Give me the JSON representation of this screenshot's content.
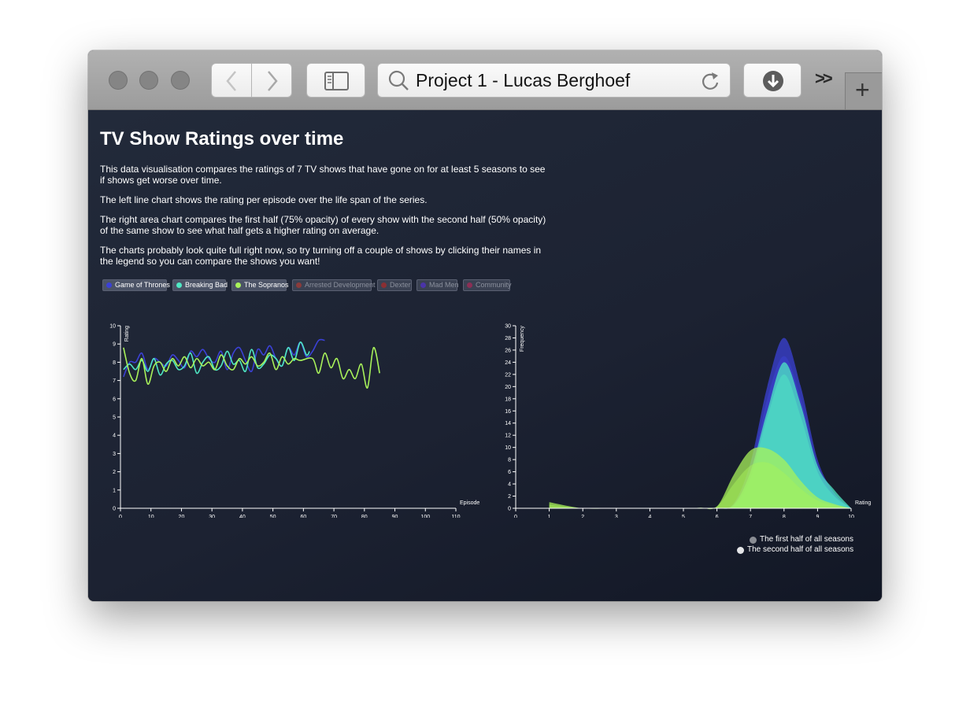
{
  "browser": {
    "address_title": "Project 1 - Lucas Berghoef",
    "overflow_label": ">>",
    "new_tab_label": "+"
  },
  "page": {
    "title": "TV Show Ratings over time",
    "paragraphs": [
      "This data visualisation compares the ratings of 7 TV shows that have gone on for at least 5 seasons to see if shows get worse over time.",
      "The left line chart shows the rating per episode over the life span of the series.",
      "The right area chart compares the first half (75% opacity) of every show with the second half (50% opacity) of the same show to see what half gets a higher rating on average.",
      "The charts probably look quite full right now, so try turning off a couple of shows by clicking their names in the legend so you can compare the shows you want!"
    ]
  },
  "legend": {
    "shows": [
      {
        "label": "Game of Thrones",
        "color": "#3b41d6",
        "active": true
      },
      {
        "label": "Breaking Bad",
        "color": "#4fe8c4",
        "active": true
      },
      {
        "label": "The Sopranos",
        "color": "#a8f25a",
        "active": true
      },
      {
        "label": "Arrested Development",
        "color": "#8a3b3b",
        "active": false
      },
      {
        "label": "Dexter",
        "color": "#8a2f33",
        "active": false
      },
      {
        "label": "Mad Men",
        "color": "#4a34a8",
        "active": false
      },
      {
        "label": "Community",
        "color": "#8a2f55",
        "active": false
      }
    ]
  },
  "area_legend": {
    "first": {
      "label": "The first half of all seasons",
      "color": "#8a8d94"
    },
    "second": {
      "label": "The second half of all seasons",
      "color": "#e4e5e8"
    }
  },
  "chart_data": [
    {
      "type": "line",
      "xlabel": "Episode",
      "ylabel": "Rating",
      "xlim": [
        0,
        110
      ],
      "ylim": [
        0,
        10
      ],
      "x_ticks": [
        0,
        10,
        20,
        30,
        40,
        50,
        60,
        70,
        80,
        90,
        100,
        110
      ],
      "y_ticks": [
        0,
        1,
        2,
        3,
        4,
        5,
        6,
        7,
        8,
        9,
        10
      ],
      "grid": false,
      "series": [
        {
          "name": "Game of Thrones",
          "color": "#3b41d6",
          "x": [
            1,
            3,
            5,
            7,
            9,
            11,
            13,
            15,
            17,
            19,
            21,
            23,
            25,
            27,
            29,
            31,
            33,
            35,
            37,
            39,
            41,
            43,
            45,
            47,
            49,
            51,
            53,
            55,
            57,
            59,
            61,
            63,
            65,
            67
          ],
          "y": [
            7.2,
            8.0,
            8.0,
            8.5,
            7.6,
            8.2,
            8.0,
            7.8,
            8.4,
            8.1,
            7.7,
            8.6,
            8.3,
            8.7,
            8.2,
            8.0,
            8.6,
            7.6,
            8.5,
            8.8,
            8.1,
            7.5,
            8.7,
            8.4,
            8.9,
            8.2,
            7.8,
            8.8,
            8.4,
            9.1,
            8.3,
            8.6,
            9.2,
            9.2
          ]
        },
        {
          "name": "Breaking Bad",
          "color": "#4fe8c4",
          "x": [
            1,
            3,
            5,
            7,
            9,
            11,
            13,
            15,
            17,
            19,
            21,
            23,
            25,
            27,
            29,
            31,
            33,
            35,
            37,
            39,
            41,
            43,
            45,
            47,
            49,
            51,
            53,
            55,
            57,
            59,
            61,
            62
          ],
          "y": [
            7.6,
            7.9,
            7.6,
            8.1,
            7.5,
            8.2,
            7.3,
            7.9,
            8.1,
            7.6,
            7.8,
            8.5,
            7.4,
            8.0,
            8.3,
            7.6,
            7.8,
            8.6,
            7.9,
            8.1,
            7.5,
            8.7,
            7.7,
            7.9,
            8.4,
            8.2,
            7.8,
            8.8,
            8.1,
            9.1,
            8.4,
            8.6
          ]
        },
        {
          "name": "The Sopranos",
          "color": "#a8f25a",
          "x": [
            1,
            3,
            5,
            7,
            9,
            11,
            13,
            15,
            17,
            19,
            21,
            23,
            25,
            27,
            29,
            31,
            33,
            35,
            37,
            39,
            41,
            43,
            45,
            47,
            49,
            51,
            53,
            55,
            57,
            59,
            63,
            65,
            67,
            69,
            71,
            73,
            75,
            77,
            79,
            81,
            83,
            85
          ],
          "y": [
            8.8,
            7.4,
            7.0,
            8.2,
            6.8,
            7.8,
            8.0,
            7.5,
            8.2,
            7.8,
            8.3,
            7.7,
            8.2,
            7.8,
            8.0,
            7.6,
            8.4,
            7.8,
            7.6,
            8.2,
            7.9,
            8.3,
            7.8,
            8.0,
            8.5,
            7.6,
            8.3,
            7.9,
            8.2,
            8.1,
            8.2,
            7.4,
            8.5,
            7.7,
            8.2,
            7.1,
            7.6,
            7.1,
            7.9,
            6.6,
            8.8,
            7.4
          ]
        }
      ]
    },
    {
      "type": "area",
      "xlabel": "Rating",
      "ylabel": "Frequency",
      "xlim": [
        0,
        10
      ],
      "ylim": [
        0,
        30
      ],
      "x_ticks": [
        0,
        1,
        2,
        3,
        4,
        5,
        6,
        7,
        8,
        9,
        10
      ],
      "y_ticks": [
        0,
        2,
        4,
        6,
        8,
        10,
        12,
        14,
        16,
        18,
        20,
        22,
        24,
        26,
        28,
        30
      ],
      "grid": false,
      "x": [
        1,
        2,
        3,
        4,
        5,
        5.5,
        6,
        6.5,
        7,
        7.5,
        8,
        8.5,
        9,
        9.5,
        10
      ],
      "series": [
        {
          "name": "Game of Thrones",
          "color": "#3b41d6",
          "first_half": [
            0,
            0,
            0,
            0,
            0,
            0,
            0,
            0.8,
            7.5,
            20,
            28,
            20,
            8,
            2.5,
            0
          ],
          "second_half": [
            0,
            0,
            0,
            0,
            0,
            0,
            0,
            0.5,
            6,
            18,
            25,
            18,
            7,
            2,
            0
          ]
        },
        {
          "name": "Breaking Bad",
          "color": "#4fe8c4",
          "first_half": [
            0,
            0,
            0,
            0,
            0,
            0,
            0,
            0.6,
            6,
            16,
            24,
            17,
            7,
            3,
            0
          ],
          "second_half": [
            0,
            0,
            0,
            0,
            0,
            0,
            0,
            0.4,
            5,
            15,
            22,
            15,
            6,
            2,
            0
          ]
        },
        {
          "name": "The Sopranos",
          "color": "#a8f25a",
          "first_half": [
            1,
            0,
            0,
            0,
            0,
            0.1,
            0.3,
            5.5,
            9.5,
            9.8,
            8,
            4.5,
            1.8,
            0.7,
            0
          ],
          "second_half": [
            0.6,
            0,
            0,
            0,
            0,
            0.1,
            0.3,
            4,
            7,
            7.5,
            5.8,
            3.2,
            1.3,
            0.5,
            0
          ]
        }
      ]
    }
  ]
}
